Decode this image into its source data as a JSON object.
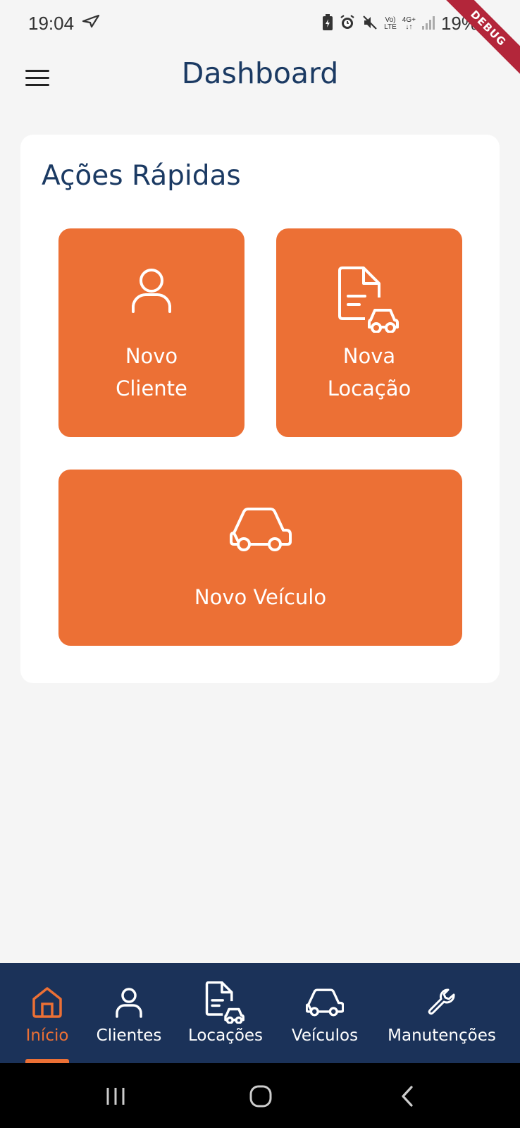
{
  "status_bar": {
    "time": "19:04",
    "battery_percent": "19%",
    "debug_label": "DEBUG",
    "network_top": "Vo)",
    "network_bottom": "LTE",
    "signal_label": "4G+",
    "icons": [
      "navigation-icon",
      "battery-saver-icon",
      "alarm-icon",
      "mute-icon",
      "volte-icon",
      "4g-icon",
      "signal-icon"
    ]
  },
  "app_bar": {
    "title": "Dashboard",
    "menu_icon": "hamburger-menu-icon"
  },
  "quick_actions": {
    "title": "Ações Rápidas",
    "items": [
      {
        "label": "Novo\nCliente",
        "icon": "person-icon"
      },
      {
        "label": "Nova\nLocação",
        "icon": "document-car-icon"
      },
      {
        "label": "Novo Veículo",
        "icon": "car-icon"
      }
    ]
  },
  "bottom_nav": {
    "items": [
      {
        "label": "Início",
        "icon": "home-icon",
        "active": true
      },
      {
        "label": "Clientes",
        "icon": "person-icon",
        "active": false
      },
      {
        "label": "Locações",
        "icon": "document-car-icon",
        "active": false
      },
      {
        "label": "Veículos",
        "icon": "car-icon",
        "active": false
      },
      {
        "label": "Manutenções",
        "icon": "wrench-icon",
        "active": false
      }
    ]
  },
  "system_nav": {
    "items": [
      "recents-icon",
      "home-circle-icon",
      "back-icon"
    ]
  },
  "colors": {
    "accent": "#ec7035",
    "primary": "#1b3a63",
    "nav_background": "#1b3259",
    "background": "#f5f5f5"
  }
}
